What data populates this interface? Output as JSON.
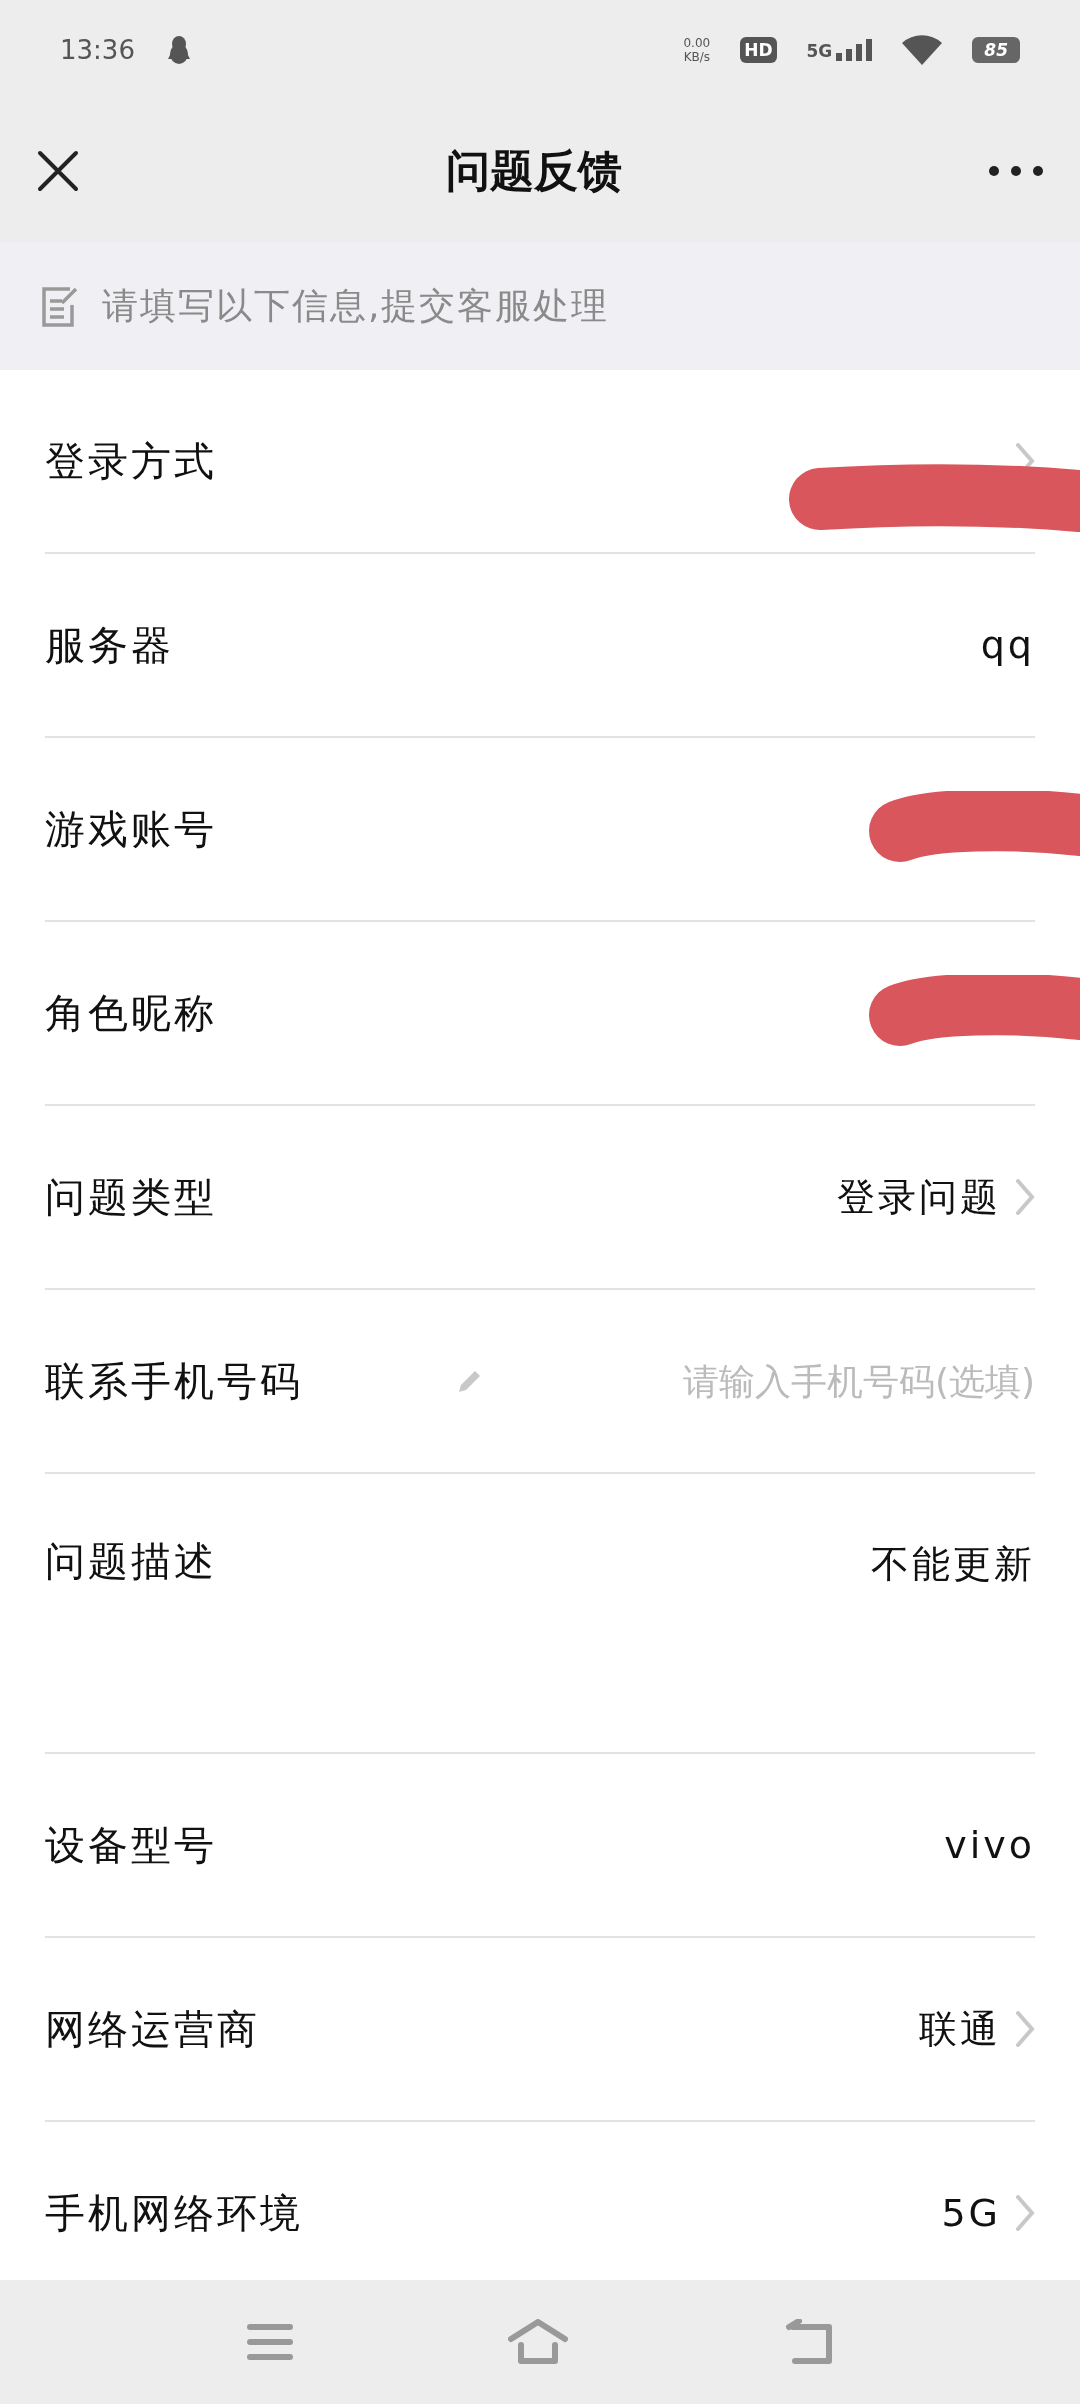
{
  "status_bar": {
    "time": "13:36",
    "net_speed": "0.00",
    "net_unit": "KB/s",
    "hd": "HD",
    "network": "5G",
    "battery": "85"
  },
  "header": {
    "title": "问题反馈"
  },
  "notice": {
    "text": "请填写以下信息,提交客服处理"
  },
  "rows": [
    {
      "label": "登录方式",
      "kind": "redacted",
      "chevron": true
    },
    {
      "label": "服务器",
      "kind": "text",
      "value": "qq",
      "chevron": false
    },
    {
      "label": "游戏账号",
      "kind": "redacted",
      "chevron": false
    },
    {
      "label": "角色昵称",
      "kind": "redacted",
      "chevron": false
    },
    {
      "label": "问题类型",
      "kind": "text",
      "value": "登录问题",
      "chevron": true
    },
    {
      "label": "联系手机号码",
      "kind": "input",
      "placeholder": "请输入手机号码(选填)",
      "chevron": false
    },
    {
      "label": "问题描述",
      "kind": "textarea",
      "value": "不能更新",
      "chevron": false
    },
    {
      "label": "设备型号",
      "kind": "text",
      "value": "vivo",
      "chevron": false
    },
    {
      "label": "网络运营商",
      "kind": "text",
      "value": "联通",
      "chevron": true
    },
    {
      "label": "手机网络环境",
      "kind": "text",
      "value": "5G",
      "chevron": true
    }
  ]
}
